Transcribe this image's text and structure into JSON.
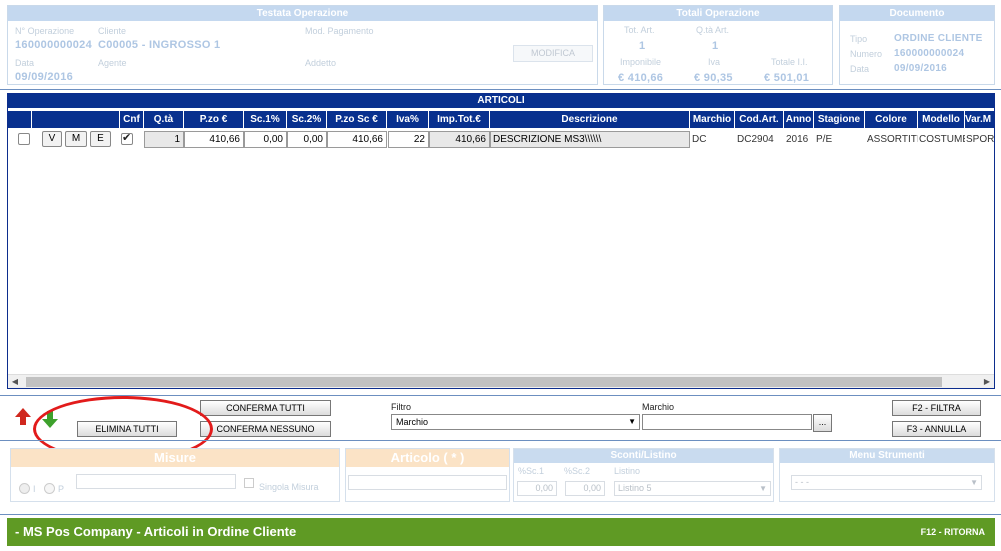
{
  "testata": {
    "title": "Testata Operazione",
    "n_operazione_label": "N° Operazione",
    "n_operazione": "160000000024",
    "cliente_label": "Cliente",
    "cliente": "C00005 - INGROSSO 1",
    "mod_pagamento_label": "Mod. Pagamento",
    "data_label": "Data",
    "data": "09/09/2016",
    "agente_label": "Agente",
    "addetto_label": "Addetto",
    "modifica_button": "MODIFICA"
  },
  "totali": {
    "title": "Totali Operazione",
    "tot_art_label": "Tot. Art.",
    "tot_art": "1",
    "qta_art_label": "Q.tà Art.",
    "qta_art": "1",
    "imponibile_label": "Imponibile",
    "imponibile": "€ 410,66",
    "iva_label": "Iva",
    "iva": "€ 90,35",
    "totale_label": "Totale I.I.",
    "totale": "€ 501,01"
  },
  "documento": {
    "title": "Documento",
    "tipo_label": "Tipo",
    "tipo": "ORDINE CLIENTE",
    "numero_label": "Numero",
    "numero": "160000000024",
    "data_label": "Data",
    "data": "09/09/2016"
  },
  "articoli": {
    "title": "ARTICOLI",
    "columns": [
      "Cnf",
      "Q.tà",
      "P.zo €",
      "Sc.1%",
      "Sc.2%",
      "P.zo Sc €",
      "Iva%",
      "Imp.Tot.€",
      "Descrizione",
      "Marchio",
      "Cod.Art.",
      "Anno",
      "Stagione",
      "Colore",
      "Modello",
      "Var.M"
    ],
    "row": {
      "btn_v": "V",
      "btn_m": "M",
      "btn_e": "E",
      "qta": "1",
      "prezzo": "410,66",
      "sc1": "0,00",
      "sc2": "0,00",
      "prezzo_sc": "410,66",
      "iva": "22",
      "imp_tot": "410,66",
      "descrizione": "DESCRIZIONE MS3\\\\\\\\\\\\",
      "marchio": "DC",
      "cod_art": "DC2904",
      "anno": "2016",
      "stagione": "P/E",
      "colore": "ASSORTITI",
      "modello": "COSTUME",
      "var": "SPORT"
    }
  },
  "toolbar": {
    "conferma_tutti": "CONFERMA TUTTI",
    "conferma_nessuno": "CONFERMA NESSUNO",
    "elimina_tutti": "ELIMINA TUTTI",
    "filtro_label": "Filtro",
    "filtro_value": "Marchio",
    "marchio_label": "Marchio",
    "browse": "...",
    "filtra": "F2 - FILTRA",
    "annulla": "F3 - ANNULLA"
  },
  "lower": {
    "misure_title": "Misure",
    "radio_i": "I",
    "radio_p": "P",
    "singola_misura": "Singola Misura",
    "articolo_title": "Articolo ( * )",
    "sconti_title": "Sconti/Listino",
    "sc1_label": "%Sc.1",
    "sc2_label": "%Sc.2",
    "listino_label": "Listino",
    "sc1_value": "0,00",
    "sc2_value": "0,00",
    "listino_value": "Listino 5",
    "menu_title": "Menu Strumenti",
    "menu_value": "- - -"
  },
  "footer": {
    "title": "- MS Pos Company - Articoli in Ordine Cliente",
    "ritorna": "F12 - RITORNA"
  },
  "colors": {
    "header_blue": "#08308e",
    "footer_green": "#5f9a24",
    "annotation_red": "#e21b1b"
  }
}
